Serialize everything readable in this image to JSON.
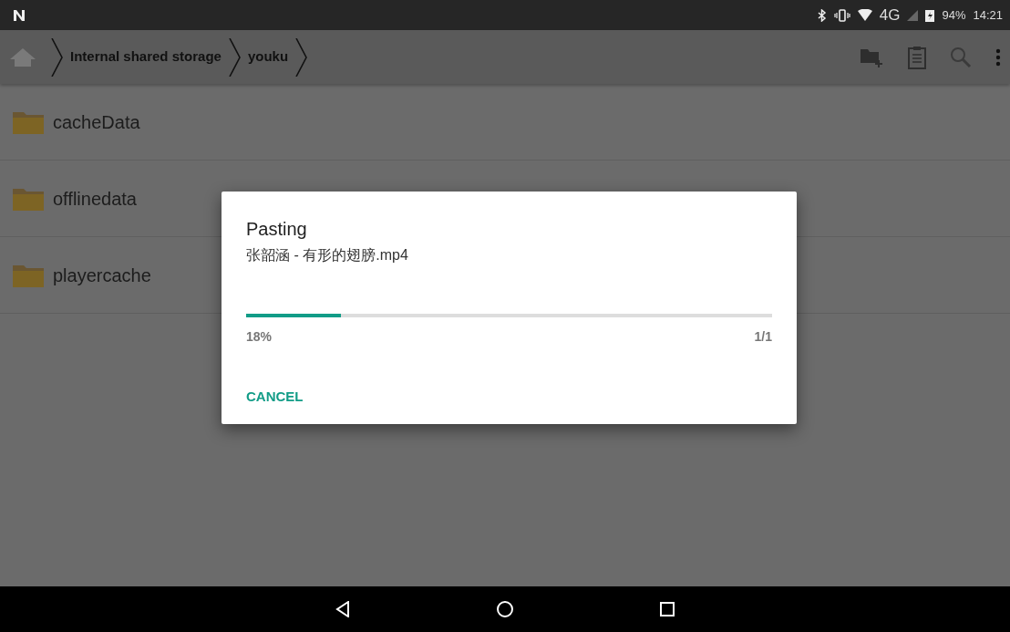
{
  "status_bar": {
    "network": "4G",
    "battery": "94%",
    "time": "14:21"
  },
  "breadcrumb": [
    {
      "label": "Internal shared storage"
    },
    {
      "label": "youku"
    }
  ],
  "files": [
    {
      "name": "cacheData"
    },
    {
      "name": "offlinedata"
    },
    {
      "name": "playercache"
    }
  ],
  "dialog": {
    "title": "Pasting",
    "file": "张韶涵 - 有形的翅膀.mp4",
    "level": 0.18,
    "percent": "18%",
    "count": "1/1",
    "button": "CANCEL"
  }
}
